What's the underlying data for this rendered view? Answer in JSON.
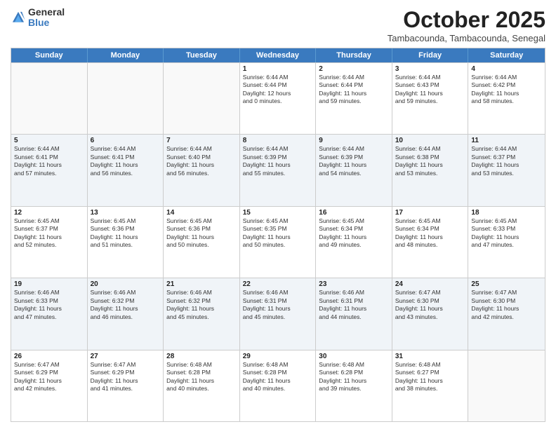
{
  "logo": {
    "general": "General",
    "blue": "Blue"
  },
  "title": "October 2025",
  "location": "Tambacounda, Tambacounda, Senegal",
  "headers": [
    "Sunday",
    "Monday",
    "Tuesday",
    "Wednesday",
    "Thursday",
    "Friday",
    "Saturday"
  ],
  "rows": [
    [
      {
        "day": "",
        "info": ""
      },
      {
        "day": "",
        "info": ""
      },
      {
        "day": "",
        "info": ""
      },
      {
        "day": "1",
        "info": "Sunrise: 6:44 AM\nSunset: 6:44 PM\nDaylight: 12 hours\nand 0 minutes."
      },
      {
        "day": "2",
        "info": "Sunrise: 6:44 AM\nSunset: 6:44 PM\nDaylight: 11 hours\nand 59 minutes."
      },
      {
        "day": "3",
        "info": "Sunrise: 6:44 AM\nSunset: 6:43 PM\nDaylight: 11 hours\nand 59 minutes."
      },
      {
        "day": "4",
        "info": "Sunrise: 6:44 AM\nSunset: 6:42 PM\nDaylight: 11 hours\nand 58 minutes."
      }
    ],
    [
      {
        "day": "5",
        "info": "Sunrise: 6:44 AM\nSunset: 6:41 PM\nDaylight: 11 hours\nand 57 minutes."
      },
      {
        "day": "6",
        "info": "Sunrise: 6:44 AM\nSunset: 6:41 PM\nDaylight: 11 hours\nand 56 minutes."
      },
      {
        "day": "7",
        "info": "Sunrise: 6:44 AM\nSunset: 6:40 PM\nDaylight: 11 hours\nand 56 minutes."
      },
      {
        "day": "8",
        "info": "Sunrise: 6:44 AM\nSunset: 6:39 PM\nDaylight: 11 hours\nand 55 minutes."
      },
      {
        "day": "9",
        "info": "Sunrise: 6:44 AM\nSunset: 6:39 PM\nDaylight: 11 hours\nand 54 minutes."
      },
      {
        "day": "10",
        "info": "Sunrise: 6:44 AM\nSunset: 6:38 PM\nDaylight: 11 hours\nand 53 minutes."
      },
      {
        "day": "11",
        "info": "Sunrise: 6:44 AM\nSunset: 6:37 PM\nDaylight: 11 hours\nand 53 minutes."
      }
    ],
    [
      {
        "day": "12",
        "info": "Sunrise: 6:45 AM\nSunset: 6:37 PM\nDaylight: 11 hours\nand 52 minutes."
      },
      {
        "day": "13",
        "info": "Sunrise: 6:45 AM\nSunset: 6:36 PM\nDaylight: 11 hours\nand 51 minutes."
      },
      {
        "day": "14",
        "info": "Sunrise: 6:45 AM\nSunset: 6:36 PM\nDaylight: 11 hours\nand 50 minutes."
      },
      {
        "day": "15",
        "info": "Sunrise: 6:45 AM\nSunset: 6:35 PM\nDaylight: 11 hours\nand 50 minutes."
      },
      {
        "day": "16",
        "info": "Sunrise: 6:45 AM\nSunset: 6:34 PM\nDaylight: 11 hours\nand 49 minutes."
      },
      {
        "day": "17",
        "info": "Sunrise: 6:45 AM\nSunset: 6:34 PM\nDaylight: 11 hours\nand 48 minutes."
      },
      {
        "day": "18",
        "info": "Sunrise: 6:45 AM\nSunset: 6:33 PM\nDaylight: 11 hours\nand 47 minutes."
      }
    ],
    [
      {
        "day": "19",
        "info": "Sunrise: 6:46 AM\nSunset: 6:33 PM\nDaylight: 11 hours\nand 47 minutes."
      },
      {
        "day": "20",
        "info": "Sunrise: 6:46 AM\nSunset: 6:32 PM\nDaylight: 11 hours\nand 46 minutes."
      },
      {
        "day": "21",
        "info": "Sunrise: 6:46 AM\nSunset: 6:32 PM\nDaylight: 11 hours\nand 45 minutes."
      },
      {
        "day": "22",
        "info": "Sunrise: 6:46 AM\nSunset: 6:31 PM\nDaylight: 11 hours\nand 45 minutes."
      },
      {
        "day": "23",
        "info": "Sunrise: 6:46 AM\nSunset: 6:31 PM\nDaylight: 11 hours\nand 44 minutes."
      },
      {
        "day": "24",
        "info": "Sunrise: 6:47 AM\nSunset: 6:30 PM\nDaylight: 11 hours\nand 43 minutes."
      },
      {
        "day": "25",
        "info": "Sunrise: 6:47 AM\nSunset: 6:30 PM\nDaylight: 11 hours\nand 42 minutes."
      }
    ],
    [
      {
        "day": "26",
        "info": "Sunrise: 6:47 AM\nSunset: 6:29 PM\nDaylight: 11 hours\nand 42 minutes."
      },
      {
        "day": "27",
        "info": "Sunrise: 6:47 AM\nSunset: 6:29 PM\nDaylight: 11 hours\nand 41 minutes."
      },
      {
        "day": "28",
        "info": "Sunrise: 6:48 AM\nSunset: 6:28 PM\nDaylight: 11 hours\nand 40 minutes."
      },
      {
        "day": "29",
        "info": "Sunrise: 6:48 AM\nSunset: 6:28 PM\nDaylight: 11 hours\nand 40 minutes."
      },
      {
        "day": "30",
        "info": "Sunrise: 6:48 AM\nSunset: 6:28 PM\nDaylight: 11 hours\nand 39 minutes."
      },
      {
        "day": "31",
        "info": "Sunrise: 6:48 AM\nSunset: 6:27 PM\nDaylight: 11 hours\nand 38 minutes."
      },
      {
        "day": "",
        "info": ""
      }
    ]
  ]
}
